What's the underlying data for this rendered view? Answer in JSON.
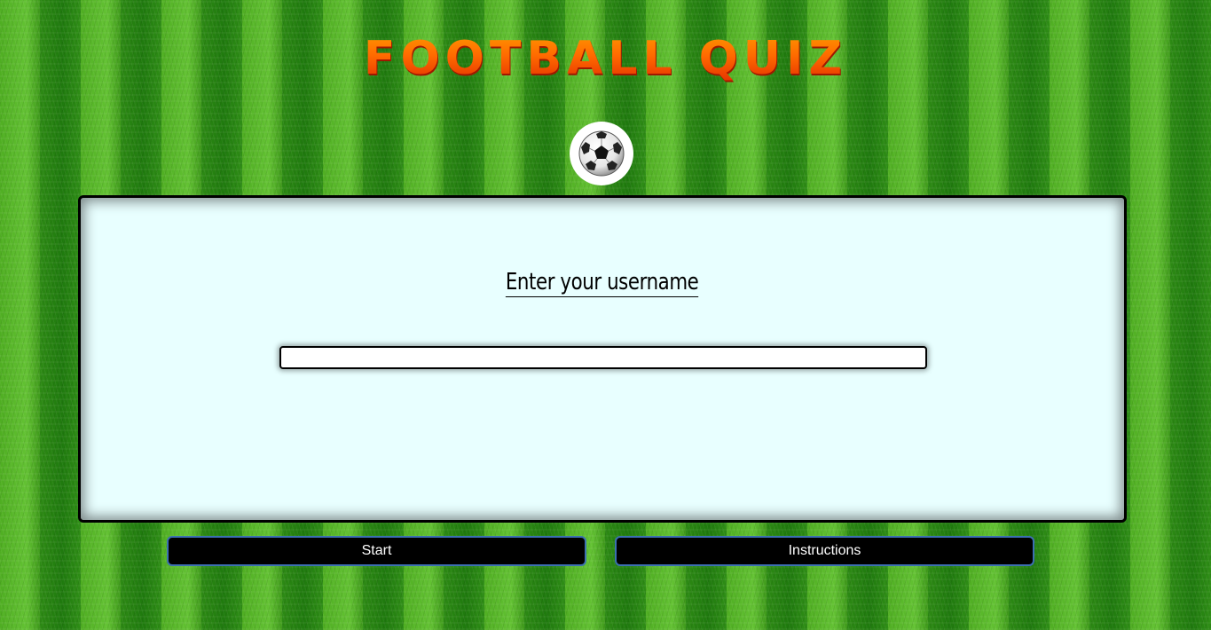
{
  "header": {
    "title": "FOOTBALL QUIZ",
    "logo_icon": "soccer-ball-icon"
  },
  "form": {
    "prompt": "Enter your username",
    "username_value": "",
    "username_placeholder": ""
  },
  "actions": {
    "start_label": "Start",
    "instructions_label": "Instructions"
  },
  "colors": {
    "title_top": "#ff9a00",
    "title_bottom": "#e02800",
    "panel_bg": "#e8ffff",
    "button_bg": "#000000",
    "button_border": "#3c6fb2",
    "grass_light": "#63c233",
    "grass_dark": "#1f7a0e"
  }
}
